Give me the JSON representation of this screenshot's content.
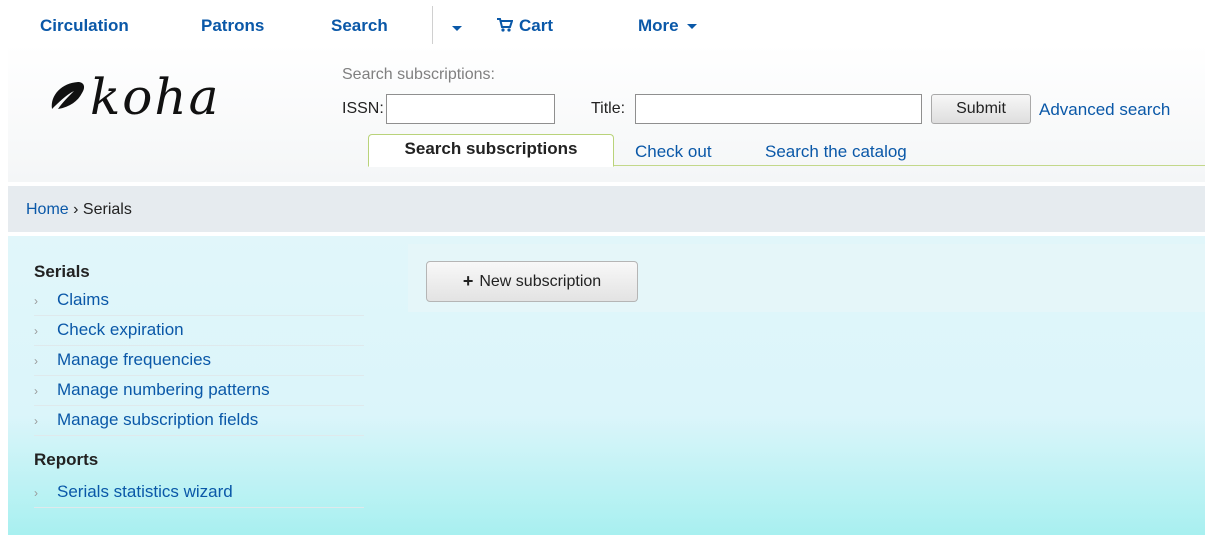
{
  "topnav": {
    "circulation": "Circulation",
    "patrons": "Patrons",
    "search": "Search",
    "cart": "Cart",
    "more": "More"
  },
  "header": {
    "logo_text": "koha",
    "search_caption": "Search subscriptions:",
    "issn_label": "ISSN:",
    "issn_value": "",
    "title_label": "Title:",
    "title_value": "",
    "submit_label": "Submit",
    "advanced_search": "Advanced search",
    "tabs": [
      {
        "label": "Search subscriptions",
        "active": true
      },
      {
        "label": "Check out",
        "active": false
      },
      {
        "label": "Search the catalog",
        "active": false
      }
    ]
  },
  "breadcrumb": {
    "home": "Home",
    "separator": "›",
    "current": "Serials"
  },
  "sidebar": {
    "serials_heading": "Serials",
    "serials_items": [
      {
        "label": "Claims"
      },
      {
        "label": "Check expiration"
      },
      {
        "label": "Manage frequencies"
      },
      {
        "label": "Manage numbering patterns"
      },
      {
        "label": "Manage subscription fields"
      }
    ],
    "reports_heading": "Reports",
    "reports_items": [
      {
        "label": "Serials statistics wizard"
      }
    ]
  },
  "toolbar": {
    "new_subscription": "New subscription"
  },
  "colors": {
    "link": "#0a58a8",
    "tab_border": "#b9d37a",
    "breadcrumb_bg": "#e6ebef",
    "main_bg_top": "#e1f6fa",
    "main_bg_bottom": "#a8f0f0"
  },
  "icons": {
    "cart": "cart-icon",
    "plus": "plus-icon",
    "logo": "koha-leaf-icon"
  }
}
